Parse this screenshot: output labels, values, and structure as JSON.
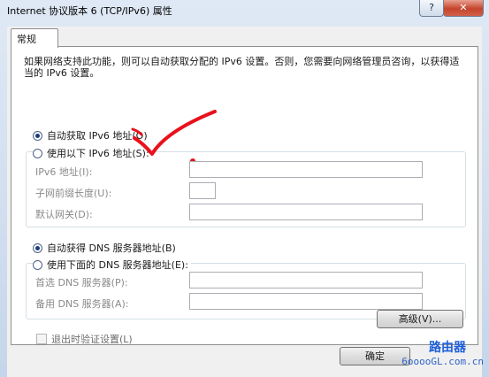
{
  "window": {
    "title": "Internet 协议版本 6 (TCP/IPv6) 属性",
    "help_glyph": "?",
    "close_glyph": "✕"
  },
  "tabs": [
    {
      "label": "常规"
    }
  ],
  "description": "如果网络支持此功能，则可以自动获取分配的 IPv6 设置。否则，您需要向网络管理员咨询，以获得适当的 IPv6 设置。",
  "ip_section": {
    "auto_label": "自动获取 IPv6 地址(O)",
    "manual_label": "使用以下 IPv6 地址(S):",
    "selected": "auto",
    "fields": [
      {
        "label": "IPv6 地址(I):",
        "value": ""
      },
      {
        "label": "子网前缀长度(U):",
        "value": ""
      },
      {
        "label": "默认网关(D):",
        "value": ""
      }
    ]
  },
  "dns_section": {
    "auto_label": "自动获得 DNS 服务器地址(B)",
    "manual_label": "使用下面的 DNS 服务器地址(E):",
    "selected": "auto",
    "fields": [
      {
        "label": "首选 DNS 服务器(P):",
        "value": ""
      },
      {
        "label": "备用 DNS 服务器(A):",
        "value": ""
      }
    ]
  },
  "validate_label": "退出时验证设置(L)",
  "validate_checked": false,
  "advanced_label": "高级(V)...",
  "ok_label": "确定",
  "watermark": {
    "top": "路由器",
    "bottom": "6ooooGL.com.cn"
  },
  "colors": {
    "annotation_red": "#e8111c",
    "watermark_blue": "#1e5fd9"
  }
}
